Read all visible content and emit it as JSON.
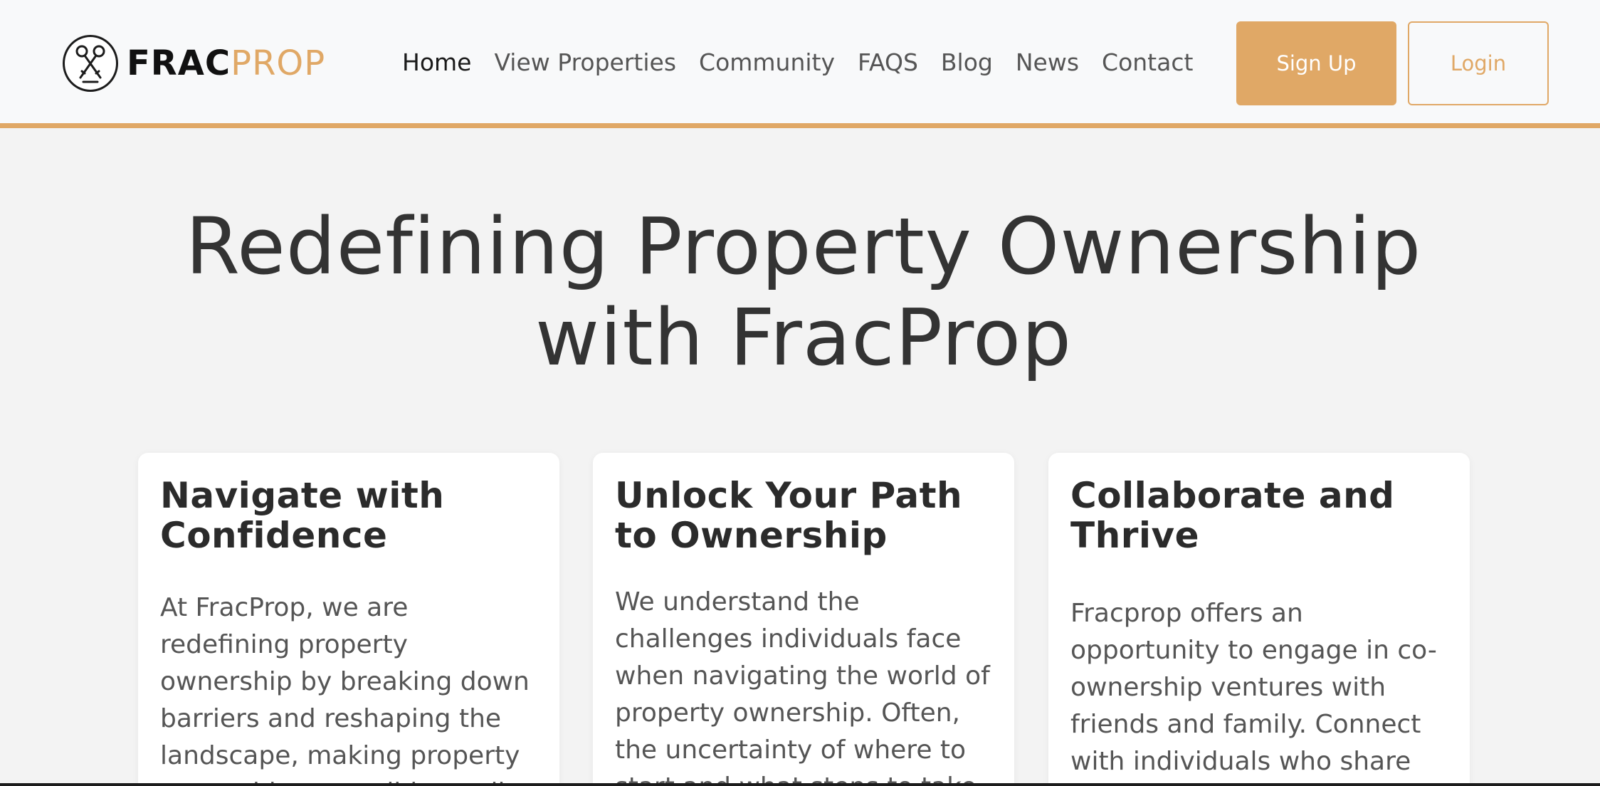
{
  "header": {
    "logo": {
      "frac": "FRAC",
      "prop": "PROP"
    },
    "nav": [
      {
        "label": "Home",
        "active": true
      },
      {
        "label": "View Properties",
        "active": false
      },
      {
        "label": "Community",
        "active": false
      },
      {
        "label": "FAQS",
        "active": false
      },
      {
        "label": "Blog",
        "active": false
      },
      {
        "label": "News",
        "active": false
      },
      {
        "label": "Contact",
        "active": false
      }
    ],
    "signup_label": "Sign Up",
    "login_label": "Login"
  },
  "hero": {
    "title_line1": "Redefining Property Ownership",
    "title_line2": "with FracProp"
  },
  "cards": [
    {
      "title": "Navigate with Confidence",
      "body": "At FracProp, we are redefining property ownership by breaking down barriers and reshaping the landscape, making property ownership accessible to all"
    },
    {
      "title": "Unlock Your Path to Ownership",
      "body": "We understand the challenges individuals face when navigating the world of property ownership. Often, the uncertainty of where to start and what steps to take"
    },
    {
      "title": "Collaborate and Thrive",
      "body": "Fracprop offers an opportunity to engage in co-ownership ventures with friends and family. Connect with individuals who share"
    }
  ],
  "colors": {
    "accent": "#e0a866",
    "text_dark": "#333333",
    "background": "#f3f3f3"
  },
  "icons": {
    "logo": "crossed-keys-icon"
  }
}
